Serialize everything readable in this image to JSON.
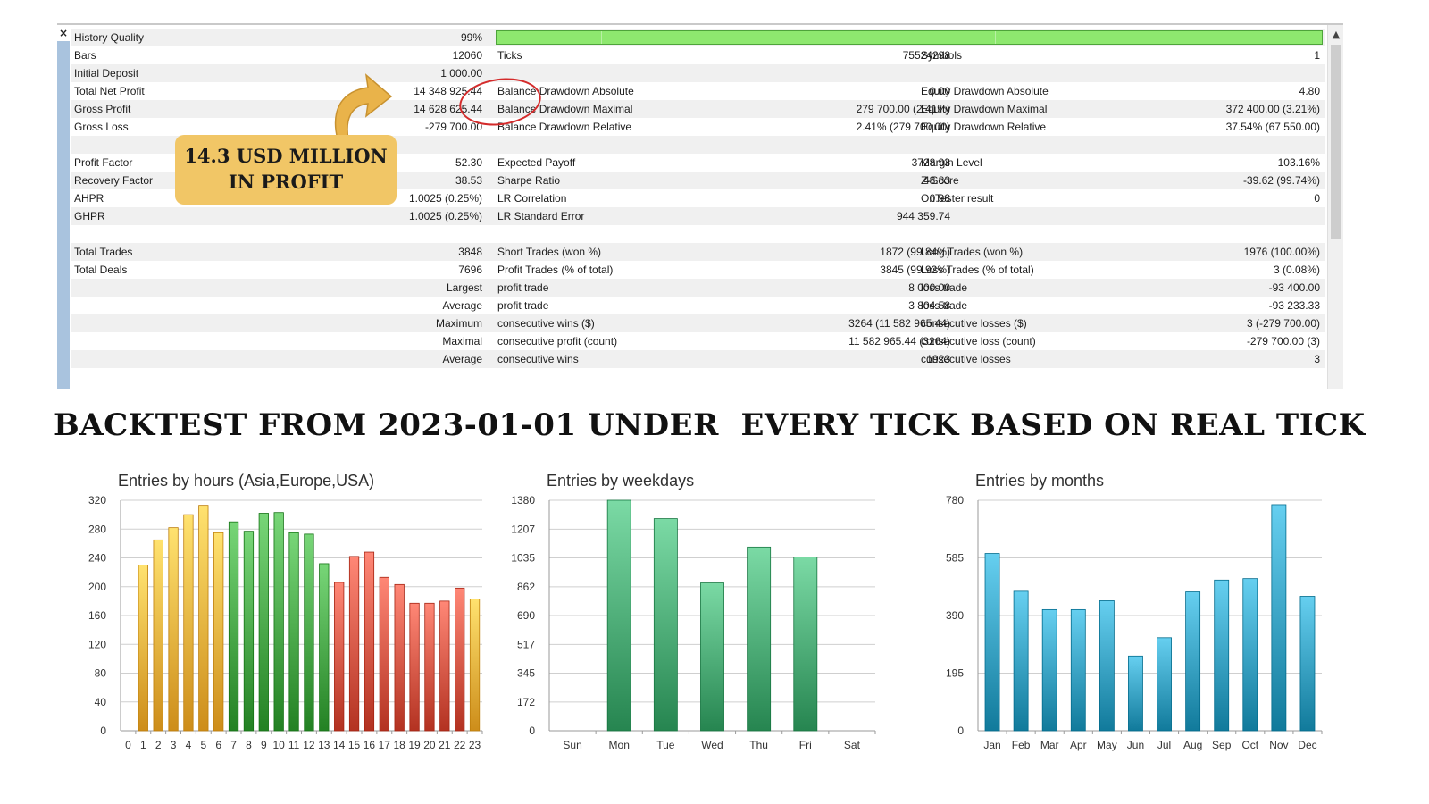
{
  "report": {
    "close_label": "×",
    "scroll_up_label": "▲",
    "history_quality": {
      "label": "History Quality",
      "value": "99%",
      "fill_fraction": 1.0,
      "bar_color": "#8ee86f"
    },
    "rows": [
      {
        "c1l": "Bars",
        "c1v": "12060",
        "c2l": "Ticks",
        "c2v": "75524298",
        "c3l": "Symbols",
        "c3v": "1"
      },
      {
        "c1l": "Initial Deposit",
        "c1v": "1 000.00",
        "c2l": "",
        "c2v": "",
        "c3l": "",
        "c3v": ""
      },
      {
        "c1l": "Total Net Profit",
        "c1v": "14 348 925.44",
        "c2l": "Balance Drawdown Absolute",
        "c2v": "0.00",
        "c3l": "Equity Drawdown Absolute",
        "c3v": "4.80"
      },
      {
        "c1l": "Gross Profit",
        "c1v": "14 628 625.44",
        "c2l": "Balance Drawdown Maximal",
        "c2v": "279 700.00 (2.41%)",
        "c3l": "Equity Drawdown Maximal",
        "c3v": "372 400.00 (3.21%)"
      },
      {
        "c1l": "Gross Loss",
        "c1v": "-279 700.00",
        "c2l": "Balance Drawdown Relative",
        "c2v": "2.41% (279 700.00)",
        "c3l": "Equity Drawdown Relative",
        "c3v": "37.54% (67 550.00)"
      },
      {
        "c1l": "",
        "c1v": "",
        "c2l": "",
        "c2v": "",
        "c3l": "",
        "c3v": ""
      },
      {
        "c1l": "Profit Factor",
        "c1v": "52.30",
        "c2l": "Expected Payoff",
        "c2v": "3728.93",
        "c3l": "Margin Level",
        "c3v": "103.16%"
      },
      {
        "c1l": "Recovery Factor",
        "c1v": "38.53",
        "c2l": "Sharpe Ratio",
        "c2v": "48.83",
        "c3l": "Z-Score",
        "c3v": "-39.62 (99.74%)"
      },
      {
        "c1l": "AHPR",
        "c1v": "1.0025 (0.25%)",
        "c2l": "LR Correlation",
        "c2v": "0.98",
        "c3l": "OnTester result",
        "c3v": "0"
      },
      {
        "c1l": "GHPR",
        "c1v": "1.0025 (0.25%)",
        "c2l": "LR Standard Error",
        "c2v": "944 359.74",
        "c3l": "",
        "c3v": ""
      },
      {
        "c1l": "",
        "c1v": "",
        "c2l": "",
        "c2v": "",
        "c3l": "",
        "c3v": ""
      },
      {
        "c1l": "Total Trades",
        "c1v": "3848",
        "c2l": "Short Trades (won %)",
        "c2v": "1872 (99.84%)",
        "c3l": "Long Trades (won %)",
        "c3v": "1976 (100.00%)"
      },
      {
        "c1l": "Total Deals",
        "c1v": "7696",
        "c2l": "Profit Trades (% of total)",
        "c2v": "3845 (99.92%)",
        "c3l": "Loss Trades (% of total)",
        "c3v": "3 (0.08%)"
      },
      {
        "c1r": "Largest",
        "c2l": "profit trade",
        "c2v": "8 000.00",
        "c3l": "loss trade",
        "c3v": "-93 400.00"
      },
      {
        "c1r": "Average",
        "c2l": "profit trade",
        "c2v": "3 804.58",
        "c3l": "loss trade",
        "c3v": "-93 233.33"
      },
      {
        "c1r": "Maximum",
        "c2l": "consecutive wins ($)",
        "c2v": "3264 (11 582 965.44)",
        "c3l": "consecutive losses ($)",
        "c3v": "3 (-279 700.00)"
      },
      {
        "c1r": "Maximal",
        "c2l": "consecutive profit (count)",
        "c2v": "11 582 965.44 (3264)",
        "c3l": "consecutive loss (count)",
        "c3v": "-279 700.00 (3)"
      },
      {
        "c1r": "Average",
        "c2l": "consecutive wins",
        "c2v": "1923",
        "c3l": "consecutive losses",
        "c3v": "3"
      }
    ],
    "highlight_color": "#d42b2b"
  },
  "callout": {
    "line1": "14.3 USD MILLION",
    "line2": "IN PROFIT",
    "color": "#f1c666",
    "arrow_color": "#e9b34a"
  },
  "heading": "BACKTEST FROM 2023-01-01 UNDER  EVERY TICK BASED ON REAL TICK",
  "chart_data": [
    {
      "type": "bar",
      "title": "Entries by hours (Asia,Europe,USA)",
      "categories": [
        "0",
        "1",
        "2",
        "3",
        "4",
        "5",
        "6",
        "7",
        "8",
        "9",
        "10",
        "11",
        "12",
        "13",
        "14",
        "15",
        "16",
        "17",
        "18",
        "19",
        "20",
        "21",
        "22",
        "23"
      ],
      "values": [
        null,
        230,
        265,
        282,
        300,
        313,
        275,
        290,
        277,
        302,
        303,
        275,
        273,
        232,
        206,
        242,
        248,
        213,
        203,
        177,
        177,
        180,
        198,
        183
      ],
      "ylim": [
        0,
        320
      ],
      "yticks": [
        "0",
        "40",
        "80",
        "120",
        "160",
        "200",
        "240",
        "280",
        "320"
      ],
      "colors": [
        "#e6a633",
        "#e6a633",
        "#e6a633",
        "#e6a633",
        "#e6a633",
        "#e6a633",
        "#e6a633",
        "#3c9a3c",
        "#3c9a3c",
        "#3c9a3c",
        "#3c9a3c",
        "#3c9a3c",
        "#3c9a3c",
        "#3c9a3c",
        "#cc4b3a",
        "#cc4b3a",
        "#cc4b3a",
        "#cc4b3a",
        "#cc4b3a",
        "#cc4b3a",
        "#cc4b3a",
        "#cc4b3a",
        "#cc4b3a",
        "#e6a633"
      ],
      "grid": true
    },
    {
      "type": "bar",
      "title": "Entries by weekdays",
      "categories": [
        "Sun",
        "Mon",
        "Tue",
        "Wed",
        "Thu",
        "Fri",
        "Sat"
      ],
      "values": [
        0,
        1380,
        1270,
        885,
        1100,
        1040,
        0
      ],
      "ylim": [
        0,
        1380
      ],
      "yticks": [
        "0",
        "172",
        "345",
        "517",
        "690",
        "862",
        "1035",
        "1207",
        "1380"
      ],
      "colors": [
        "#3f9e69",
        "#3f9e69",
        "#3f9e69",
        "#3f9e69",
        "#3f9e69",
        "#3f9e69",
        "#3f9e69"
      ],
      "grid": true
    },
    {
      "type": "bar",
      "title": "Entries by months",
      "categories": [
        "Jan",
        "Feb",
        "Mar",
        "Apr",
        "May",
        "Jun",
        "Jul",
        "Aug",
        "Sep",
        "Oct",
        "Nov",
        "Dec"
      ],
      "values": [
        600,
        472,
        410,
        410,
        440,
        253,
        315,
        470,
        510,
        515,
        765,
        455
      ],
      "ylim": [
        0,
        780
      ],
      "yticks": [
        "0",
        "195",
        "390",
        "585",
        "780"
      ],
      "colors": [
        "#2a93b4",
        "#2a93b4",
        "#2a93b4",
        "#2a93b4",
        "#2a93b4",
        "#2a93b4",
        "#2a93b4",
        "#2a93b4",
        "#2a93b4",
        "#2a93b4",
        "#2a93b4",
        "#2a93b4"
      ],
      "grid": true
    }
  ]
}
